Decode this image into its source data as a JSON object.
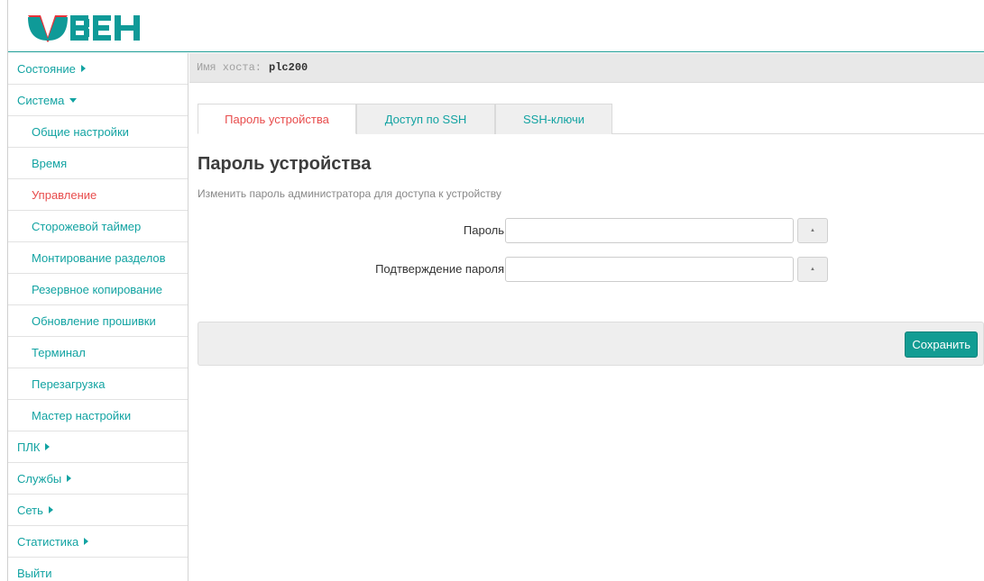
{
  "brand": {
    "logo_text": "ОВЕН",
    "colors": {
      "red": "#e8323a",
      "teal": "#0f9a98"
    }
  },
  "theme": {
    "accent": "#12a3a2",
    "active": "#e84c4c",
    "button": "#129c93"
  },
  "sidebar": {
    "items": [
      {
        "label": "Состояние",
        "type": "section",
        "state": "collapsed"
      },
      {
        "label": "Система",
        "type": "section",
        "state": "expanded"
      },
      {
        "label": "Общие настройки",
        "type": "sub"
      },
      {
        "label": "Время",
        "type": "sub"
      },
      {
        "label": "Управление",
        "type": "sub",
        "active": true
      },
      {
        "label": "Сторожевой таймер",
        "type": "sub"
      },
      {
        "label": "Монтирование разделов",
        "type": "sub"
      },
      {
        "label": "Резервное копирование",
        "type": "sub"
      },
      {
        "label": "Обновление прошивки",
        "type": "sub"
      },
      {
        "label": "Терминал",
        "type": "sub"
      },
      {
        "label": "Перезагрузка",
        "type": "sub"
      },
      {
        "label": "Мастер настройки",
        "type": "sub"
      },
      {
        "label": "ПЛК",
        "type": "section",
        "state": "collapsed"
      },
      {
        "label": "Службы",
        "type": "section",
        "state": "collapsed"
      },
      {
        "label": "Сеть",
        "type": "section",
        "state": "collapsed"
      },
      {
        "label": "Статистика",
        "type": "section",
        "state": "collapsed"
      },
      {
        "label": "Выйти",
        "type": "link"
      }
    ]
  },
  "hostbar": {
    "label": "Имя хоста:",
    "value": "plc200"
  },
  "tabs": [
    {
      "label": "Пароль устройства",
      "active": true
    },
    {
      "label": "Доступ по SSH",
      "active": false
    },
    {
      "label": "SSH-ключи",
      "active": false
    }
  ],
  "page": {
    "title": "Пароль устройства",
    "description": "Изменить пароль администратора для доступа к устройству"
  },
  "form": {
    "password_label": "Пароль",
    "password_value": "",
    "confirm_label": "Подтверждение пароля",
    "confirm_value": "",
    "reveal_glyph": "▲"
  },
  "actions": {
    "save_label": "Сохранить"
  }
}
